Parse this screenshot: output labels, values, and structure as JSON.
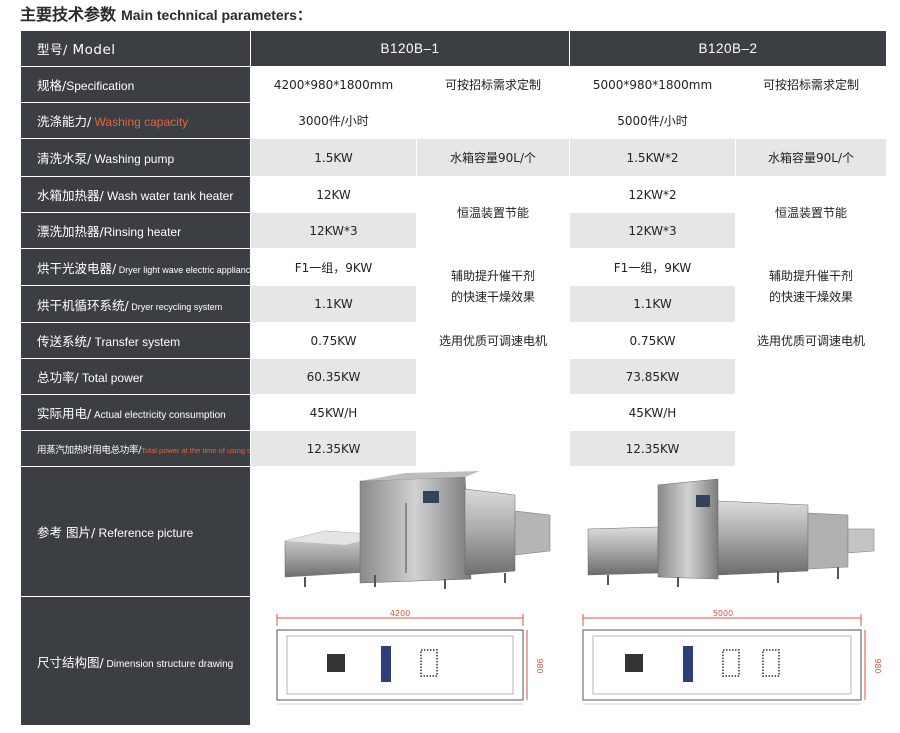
{
  "title": {
    "zh": "主要技术参数",
    "en": "Main technical parameters："
  },
  "header": {
    "label_zh": "型号/",
    "label_en": " Model",
    "col1": "B120B–1",
    "col2": "B120B–2"
  },
  "rows": {
    "spec": {
      "zh": "规格/",
      "en": "Specification",
      "c1": "4200*980*1800mm",
      "n1": "可按招标需求定制",
      "c2": "5000*980*1800mm",
      "n2": "可按招标需求定制"
    },
    "wash": {
      "zh": "洗涤能力/",
      "en": " Washing capacity",
      "c1": "3000件/小时",
      "c2": "5000件/小时"
    },
    "pump": {
      "zh": "清洗水泵/",
      "en": " Washing pump",
      "c1": "1.5KW",
      "n1": "水箱容量90L/个",
      "c2": "1.5KW*2",
      "n2": "水箱容量90L/个"
    },
    "tank": {
      "zh": "水箱加热器/",
      "en": " Wash water tank heater",
      "c1": "12KW",
      "c2": "12KW*2"
    },
    "rinse": {
      "zh": "漂洗加热器/",
      "en": "Rinsing heater",
      "c1": "12KW*3",
      "c2": "12KW*3"
    },
    "thermo": {
      "n1": "恒温装置节能",
      "n2": "恒温装置节能"
    },
    "dryer": {
      "zh": "烘干光波电器/",
      "en": " Dryer light wave electric appliance",
      "c1": "F1一组，9KW",
      "c2": "F1一组，9KW"
    },
    "recyc": {
      "zh": "烘干机循环系统/",
      "en": " Dryer recycling system",
      "c1": "1.1KW",
      "c2": "1.1KW"
    },
    "aux": {
      "n1a": "辅助提升催干剂",
      "n1b": "的快速干燥效果",
      "n2a": "辅助提升催干剂",
      "n2b": "的快速干燥效果"
    },
    "trans": {
      "zh": "传送系统/",
      "en": " Transfer system",
      "c1": "0.75KW",
      "n1": "选用优质可调速电机",
      "c2": "0.75KW",
      "n2": "选用优质可调速电机"
    },
    "total": {
      "zh": "总功率/",
      "en": " Total power",
      "c1": "60.35KW",
      "c2": "73.85KW"
    },
    "actual": {
      "zh": "实际用电/",
      "en": " Actual electricity consumption",
      "c1": "45KW/H",
      "c2": "45KW/H"
    },
    "steam": {
      "zh": "用蒸汽加热时用电总功率/",
      "en": "Total power at the time of using steam",
      "c1": "12.35KW",
      "c2": "12.35KW"
    },
    "picture": {
      "zh": "参考 图片/",
      "en": " Reference picture"
    },
    "drawing": {
      "zh": "尺寸结构图/",
      "en": " Dimension structure drawing",
      "d1": "4200",
      "d2": "5000",
      "h1": "980",
      "h2": "980"
    }
  },
  "colors": {
    "label_bg": "#3b3f44",
    "gray_cell": "#e6e6e6",
    "accent_red": "#e8613a",
    "dim_line": "#e0533a"
  }
}
